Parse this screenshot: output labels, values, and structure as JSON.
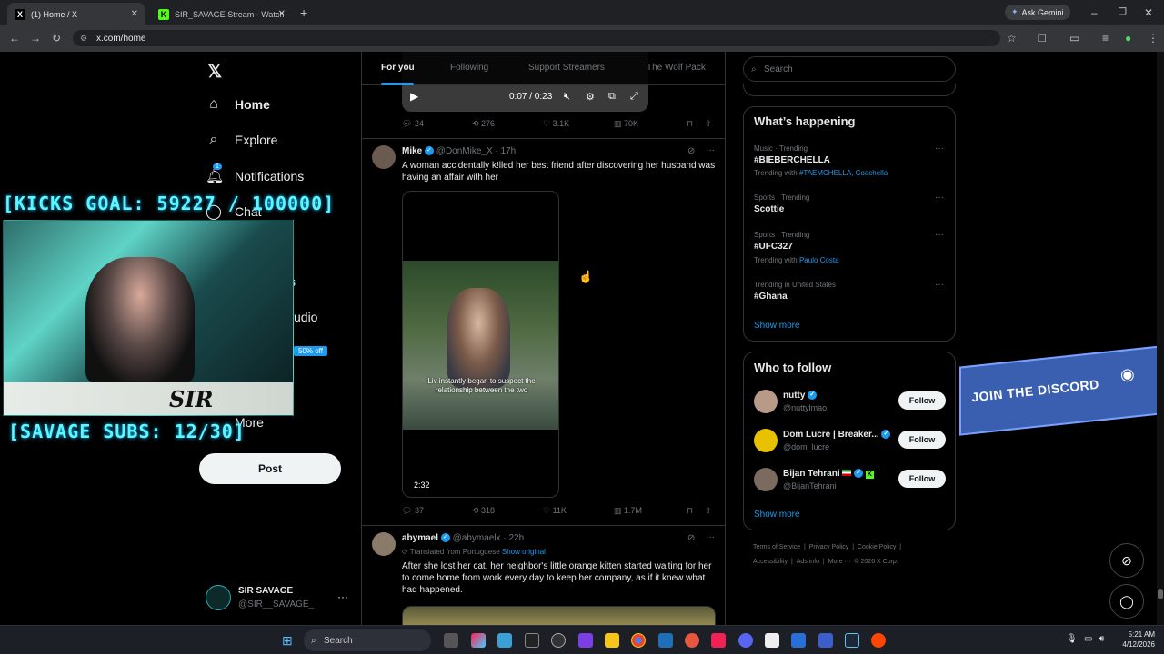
{
  "browser": {
    "tabs": [
      {
        "label": "(1) Home / X",
        "active": true
      },
      {
        "label": "SIR_SAVAGE Stream - Watch Liv",
        "active": false
      }
    ],
    "url": "x.com/home",
    "ask_gemini": "Ask Gemini"
  },
  "nav": {
    "items": [
      {
        "label": "Home",
        "icon": "home-icon"
      },
      {
        "label": "Explore",
        "icon": "search-icon"
      },
      {
        "label": "Notifications",
        "icon": "bell-icon",
        "badge": "1"
      },
      {
        "label": "Chat",
        "icon": "chat-icon"
      },
      {
        "label": "s"
      },
      {
        "label": "udio"
      },
      {
        "label": "More"
      }
    ],
    "post_label": "Post",
    "premium_badge": "50% off",
    "account": {
      "name": "SIR SAVAGE",
      "handle": "@SIR__SAVAGE_"
    }
  },
  "stream_overlay": {
    "kicks_goal": "[KICKS GOAL: 59227 / 100000]",
    "subs_goal": "[SAVAGE SUBS: 12/30]",
    "watermark": "SIR SAVAGE"
  },
  "feed": {
    "tabs": [
      "For you",
      "Following",
      "Support Streamers",
      "The Wolf Pack"
    ],
    "video_time": "0:07 / 0:23",
    "tweet0_actions": {
      "replies": "24",
      "reposts": "276",
      "likes": "3.1K",
      "views": "70K"
    },
    "tweet1": {
      "name": "Mike",
      "handle": "@DonMike_X",
      "time": "17h",
      "text": "A woman accidentally k!lled her best friend after discovering her husband was having an affair with her",
      "caption": "Liv instantly began to suspect the relationship between the two",
      "duration": "2:32",
      "actions": {
        "replies": "37",
        "reposts": "318",
        "likes": "11K",
        "views": "1.7M"
      }
    },
    "tweet2": {
      "name": "abymael",
      "handle": "@abymaelx",
      "time": "22h",
      "translated": "Translated from Portuguese",
      "show_original": "Show original",
      "text": "After she lost her cat, her neighbor's little orange kitten started waiting for her to come home from work every day to keep her company, as if it knew what had happened."
    }
  },
  "right": {
    "search_placeholder": "Search",
    "happening_title": "What’s happening",
    "trends": [
      {
        "meta": "Music · Trending",
        "name": "#BIEBERCHELLA",
        "with_prefix": "Trending with ",
        "with": "#TAEMCHELLA, Coachella"
      },
      {
        "meta": "Sports · Trending",
        "name": "Scottie"
      },
      {
        "meta": "Sports · Trending",
        "name": "#UFC327",
        "with_prefix": "Trending with ",
        "with": "Paulo Costa"
      },
      {
        "meta": "Trending in United States",
        "name": "#Ghana"
      }
    ],
    "show_more": "Show more",
    "wtf_title": "Who to follow",
    "follow": [
      {
        "name": "nutty",
        "handle": "@nuttylmao"
      },
      {
        "name": "Dom Lucre | Breaker...",
        "handle": "@dom_lucre"
      },
      {
        "name": "Bijan Tehrani",
        "handle": "@BijanTehrani"
      }
    ],
    "follow_label": "Follow",
    "footer": [
      "Terms of Service",
      "|",
      "Privacy Policy",
      "|",
      "Cookie Policy",
      "|",
      "Accessibility",
      "|",
      "Ads info",
      "|",
      "More ···",
      "© 2026 X Corp."
    ],
    "discord": "JOIN THE DISCORD"
  },
  "taskbar": {
    "search": "Search",
    "time": "5:21 AM",
    "date": "4/12/2026"
  }
}
